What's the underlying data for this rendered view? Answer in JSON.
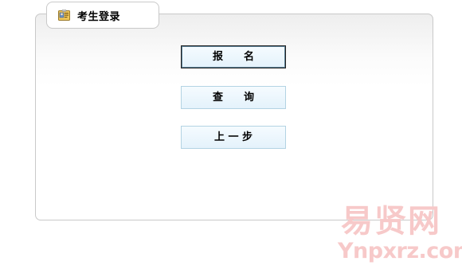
{
  "login_panel": {
    "title": "考生登录",
    "icon": "id-card-icon"
  },
  "buttons": {
    "register_label": "报　　名",
    "query_label": "查　　询",
    "back_label": "上 一 步"
  },
  "watermark": {
    "chinese": "易贤网",
    "latin": "Ynpxrz.com"
  },
  "colors": {
    "button_fill": "#e4f2fb",
    "button_border": "#b3d3e3",
    "panel_border": "#c9c9c9",
    "watermark": "#f7c9c9"
  }
}
